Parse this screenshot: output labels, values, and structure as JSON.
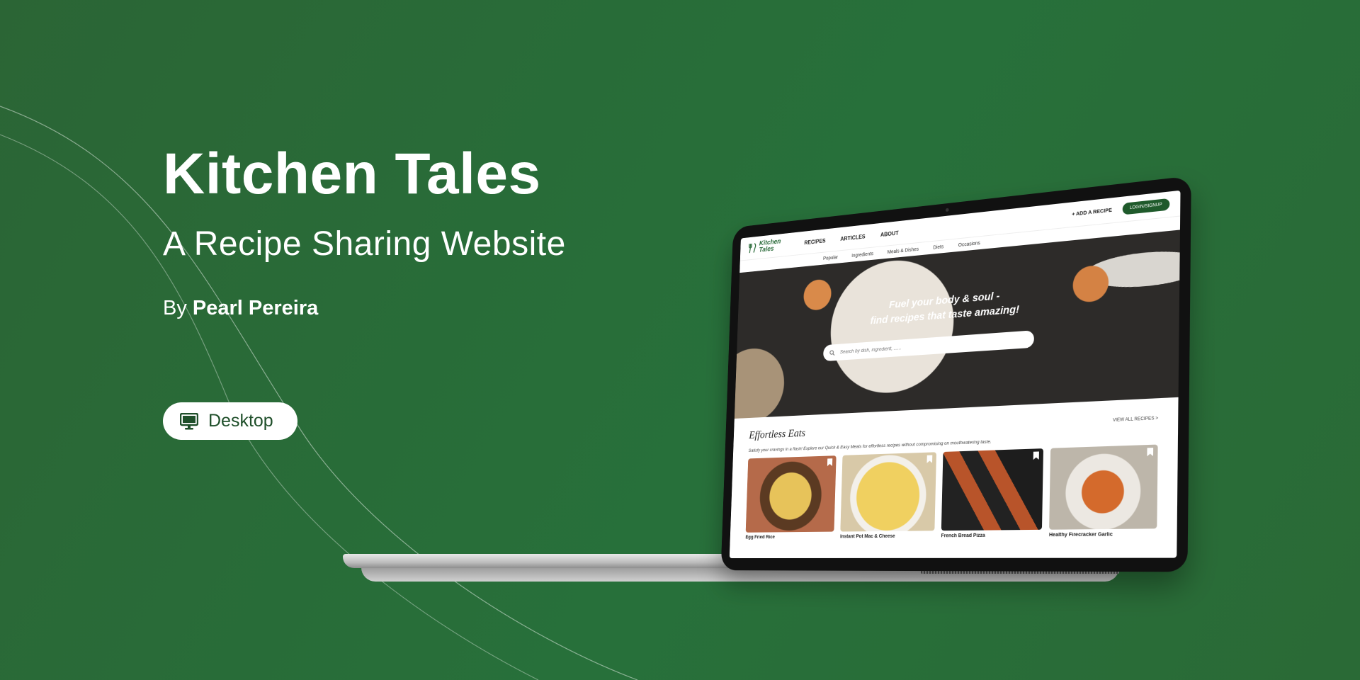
{
  "intro": {
    "title": "Kitchen Tales",
    "subtitle": "A Recipe Sharing Website",
    "author_prefix": "By",
    "author_name": "Pearl Pereira",
    "badge_label": "Desktop",
    "badge_icon": "monitor-icon"
  },
  "site": {
    "logo": "Kitchen Tales",
    "nav": [
      "RECIPES",
      "ARTICLES",
      "ABOUT"
    ],
    "add_recipe": "+ ADD A RECIPE",
    "login": "LOGIN/SIGNUP",
    "subnav": [
      "Popular",
      "Ingredients",
      "Meals & Dishes",
      "Diets",
      "Occasions"
    ],
    "hero_line1": "Fuel your body & soul -",
    "hero_line2": "find recipes that taste amazing!",
    "search_placeholder": "Search by dish, ingredient, ......",
    "section_title": "Effortless Eats",
    "view_all": "VIEW ALL RECIPES >",
    "section_desc": "Satisfy your cravings in a flash! Explore our Quick & Easy Meals for effortless recipes without compromising on mouthwatering taste.",
    "cards": [
      "Egg Fried Rice",
      "Instant Pot Mac & Cheese",
      "French Bread Pizza",
      "Healthy Firecracker Garlic"
    ]
  },
  "colors": {
    "background": "#27703a",
    "brand_green": "#1f5a2b",
    "text_white": "#ffffff"
  }
}
